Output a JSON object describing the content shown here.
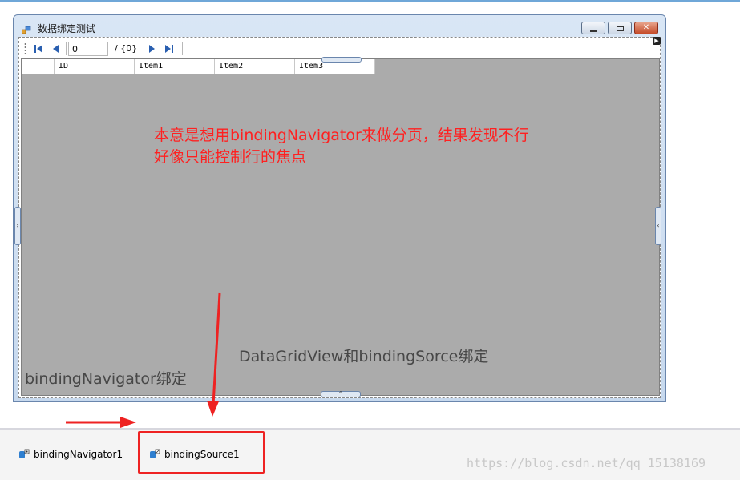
{
  "window": {
    "title": "数据绑定测试",
    "close_glyph": "✕"
  },
  "navigator": {
    "position_value": "0",
    "count_label": "/ {0}",
    "icons": [
      "move-first-icon",
      "move-previous-icon",
      "move-next-icon",
      "move-last-icon"
    ]
  },
  "grid": {
    "columns": [
      "ID",
      "Item1",
      "Item2",
      "Item3"
    ],
    "background": "#ababab"
  },
  "annotations": {
    "red_note_line1": "本意是想用bindingNavigator来做分页，结果发现不行",
    "red_note_line2": "好像只能控制行的焦点",
    "grid_binding_note": "DataGridView和bindingSorce绑定",
    "navigator_binding_note": "bindingNavigator绑定",
    "color_red": "#ff2020",
    "color_grey": "#474747"
  },
  "tray": {
    "items": [
      {
        "label": "bindingNavigator1"
      },
      {
        "label": "bindingSource1"
      }
    ]
  },
  "watermark": "https://blog.csdn.net/qq_15138169"
}
